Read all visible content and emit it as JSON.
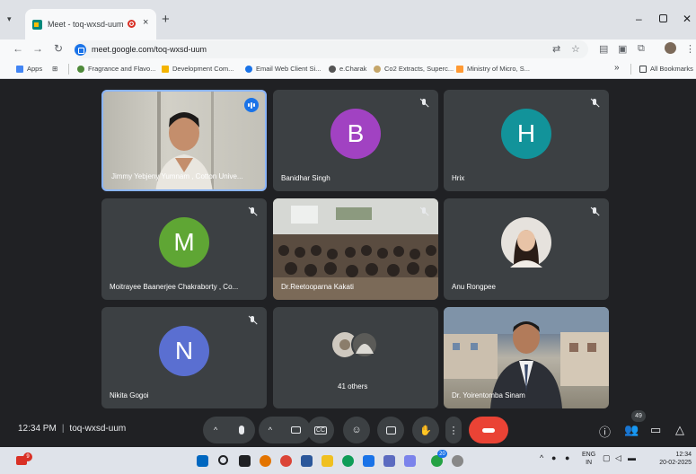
{
  "browser": {
    "tab_title": "Meet - toq-wxsd-uum",
    "new_tab_symbol": "+",
    "close_symbol": "×",
    "minimize_symbol": "–",
    "restore_symbol": "▫",
    "window_close_symbol": "✕",
    "url": "meet.google.com/toq-wxsd-uum",
    "bookmarks": [
      {
        "label": "Apps",
        "color": "#4285f4"
      },
      {
        "label": "Fragrance and Flavo...",
        "color": "#4f8a3a"
      },
      {
        "label": "Development Com...",
        "color": "#f4b400"
      },
      {
        "label": "Email Web Client Si...",
        "color": "#1a73e8"
      },
      {
        "label": "e.Charak",
        "color": "#555555"
      },
      {
        "label": "Co2 Extracts, Superc...",
        "color": "#c5a66a"
      },
      {
        "label": "Ministry of Micro, S...",
        "color": "#ff9933"
      }
    ],
    "overflow": "»",
    "all_bookmarks": "All Bookmarks"
  },
  "participants": [
    {
      "name": "Jimmy Yebjeny Yumnam , Cotton Unive...",
      "muted": false,
      "speaking": true
    },
    {
      "name": "Banidhar Singh",
      "initial": "B",
      "avatar_color": "#a142c2",
      "muted": true
    },
    {
      "name": "Hrix",
      "initial": "H",
      "avatar_color": "#12939a",
      "muted": true
    },
    {
      "name": "Moitrayee Baanerjee Chakraborty , Co...",
      "initial": "M",
      "avatar_color": "#5fa634",
      "muted": true
    },
    {
      "name": "Dr.Reetooparna Kakati",
      "muted": true
    },
    {
      "name": "Anu Rongpee",
      "muted": true
    },
    {
      "name": "Nikita Gogoi",
      "initial": "N",
      "avatar_color": "#5a6fd1",
      "muted": true
    },
    {
      "name": "41 others"
    },
    {
      "name": "Dr. Yoirentomba Sinam"
    }
  ],
  "meeting": {
    "time": "12:34 PM",
    "code": "toq-wxsd-uum",
    "people_count": "49"
  },
  "taskbar": {
    "lang_top": "ENG",
    "lang_bottom": "IN",
    "time": "12:34",
    "date": "20-02-2025",
    "notification_count": "9",
    "app_badge": "20"
  }
}
